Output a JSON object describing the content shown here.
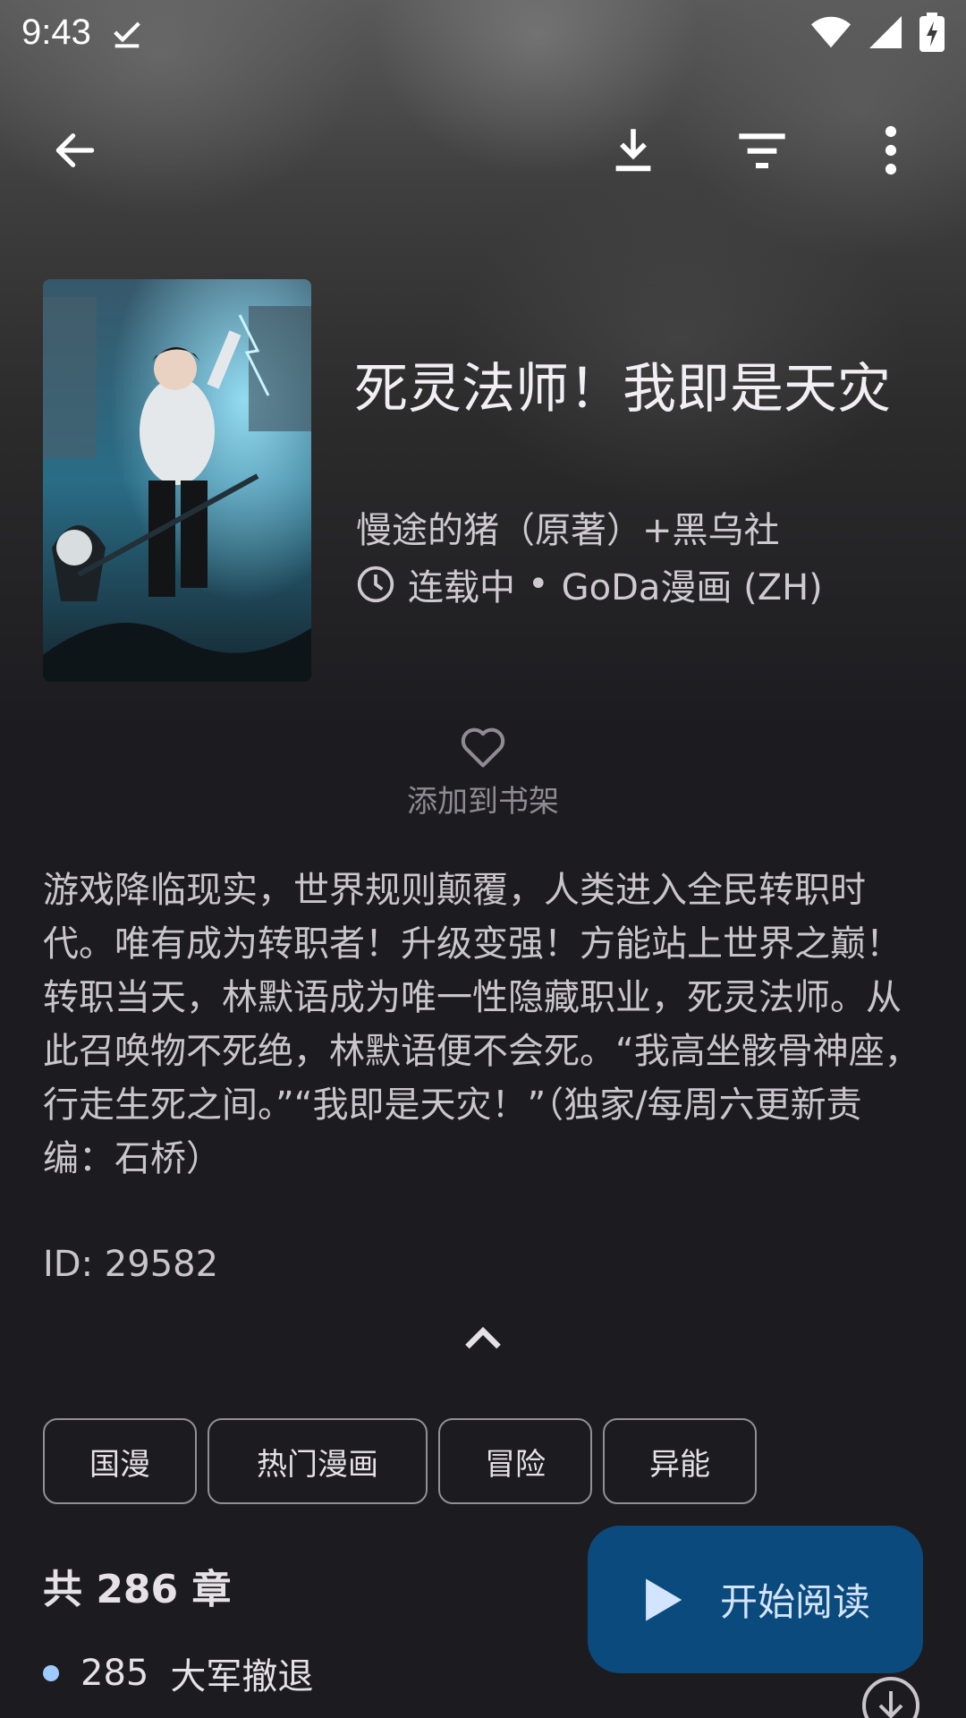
{
  "status_bar": {
    "time": "9:43"
  },
  "manga": {
    "title": "死灵法师！我即是天灾",
    "author": "慢途的猪（原著）+黑乌社",
    "status": "连载中",
    "source": "GoDa漫画 (ZH)",
    "separator": "•"
  },
  "shelf": {
    "label": "添加到书架"
  },
  "description": "游戏降临现实，世界规则颠覆，人类进入全民转职时代。唯有成为转职者！升级变强！方能站上世界之巅！转职当天，林默语成为唯一性隐藏职业，死灵法师。从此召唤物不死绝，林默语便不会死。“我高坐骸骨神座，行走生死之间。”“我即是天灾！”（独家/每周六更新责编：石桥）",
  "id_line": "ID: 29582",
  "tags": [
    "国漫",
    "热门漫画",
    "冒险",
    "异能"
  ],
  "chapters": {
    "count_label": "共 286 章",
    "first": {
      "number": "285",
      "title": "大军撤退"
    }
  },
  "fab": {
    "label": "开始阅读"
  },
  "colors": {
    "fab_bg": "#0b4a7d",
    "unread_dot": "#9ecaff"
  },
  "icons": [
    "back-arrow-icon",
    "download-icon",
    "filter-icon",
    "more-vert-icon",
    "clock-icon",
    "heart-icon",
    "chevron-up-icon",
    "play-icon",
    "download-circle-icon"
  ]
}
